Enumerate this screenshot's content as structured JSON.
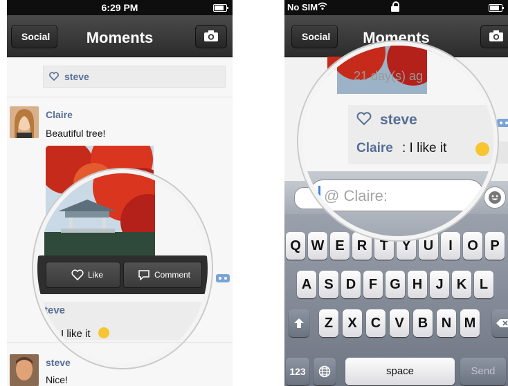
{
  "left": {
    "status": {
      "time": "6:29 PM"
    },
    "nav": {
      "back_label": "Social",
      "title": "Moments"
    },
    "top_like": {
      "name": "steve"
    },
    "post": {
      "author": "Claire",
      "text": "Beautiful tree!"
    },
    "actions": {
      "like_label": "Like",
      "comment_label": "Comment"
    },
    "like_peek": {
      "name": "teve"
    },
    "comment_peek": {
      "text": "I like it"
    },
    "next_post": {
      "author": "steve",
      "text": "Nice!"
    }
  },
  "right": {
    "status": {
      "carrier": "No SIM"
    },
    "nav": {
      "back_label": "Social",
      "title": "Moments"
    },
    "peek_time": "21 day(s) ag",
    "like": {
      "name": "steve"
    },
    "comment": {
      "author": "Claire",
      "text": ": I like it"
    },
    "input": {
      "placeholder": "@ Claire:"
    },
    "keyboard": {
      "row1": [
        "Q",
        "W",
        "E",
        "R",
        "T",
        "Y",
        "U",
        "I",
        "O",
        "P"
      ],
      "row2": [
        "A",
        "S",
        "D",
        "F",
        "G",
        "H",
        "J",
        "K",
        "L"
      ],
      "row3": [
        "Z",
        "X",
        "C",
        "V",
        "B",
        "N",
        "M"
      ],
      "num_label": "123",
      "space_label": "space",
      "send_label": "Send"
    }
  },
  "colors": {
    "link_name": "#566d95",
    "nav_bg": "#2c2c2c",
    "keyboard_bg": "#7a8290"
  },
  "icons": [
    "camera-icon",
    "heart-icon",
    "comment-icon",
    "emoji-icon",
    "globe-icon",
    "shift-icon",
    "delete-icon",
    "wifi-icon",
    "battery-icon",
    "lock-icon"
  ]
}
